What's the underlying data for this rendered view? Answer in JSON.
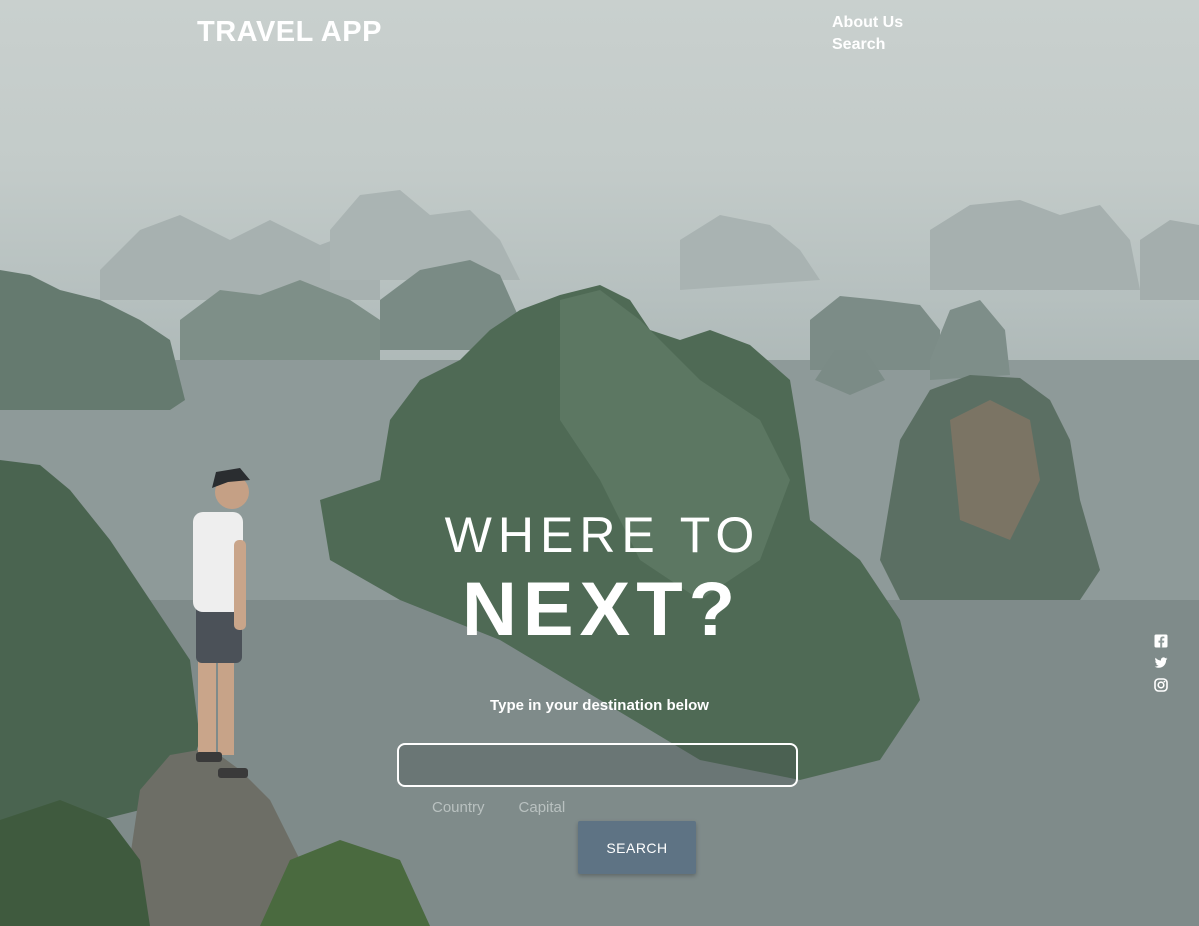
{
  "header": {
    "brand": "TRAVEL APP",
    "nav": [
      {
        "label": "About Us"
      },
      {
        "label": "Search"
      }
    ]
  },
  "hero": {
    "headline_top": "WHERE TO",
    "headline_bottom": "NEXT?",
    "subtitle": "Type in your destination below"
  },
  "search": {
    "value": "",
    "placeholder": "",
    "options": [
      "Country",
      "Capital"
    ],
    "button_label": "SEARCH"
  },
  "social": [
    {
      "icon": "facebook-icon"
    },
    {
      "icon": "twitter-icon"
    },
    {
      "icon": "instagram-icon"
    }
  ],
  "colors": {
    "button": "#5e7384",
    "option_text": "#b9c1c0"
  }
}
